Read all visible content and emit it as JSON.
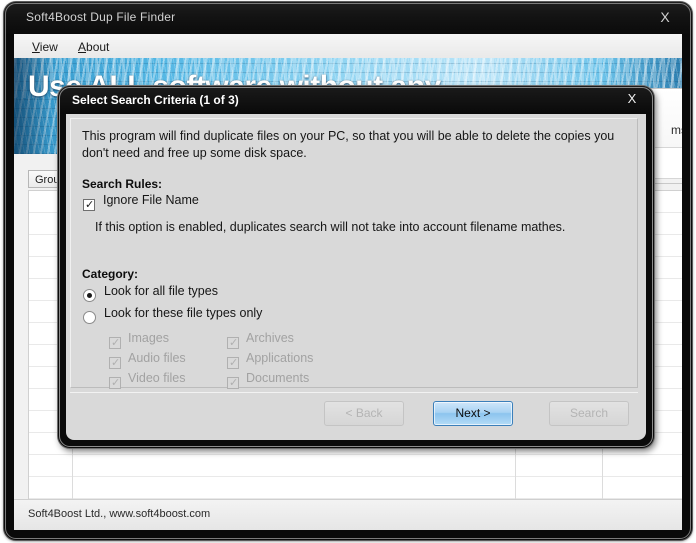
{
  "window": {
    "title": "Soft4Boost Dup File Finder",
    "close_label": "X",
    "menu": [
      {
        "label": "View",
        "accel": "V"
      },
      {
        "label": "About",
        "accel": "A"
      }
    ],
    "banner_text": "Use ALL software without any",
    "side_panel_label": "ms",
    "group_header": "Group",
    "status_text": "Soft4Boost Ltd., www.soft4boost.com"
  },
  "dialog": {
    "title": "Select Search Criteria (1 of 3)",
    "close_label": "X",
    "intro": "This program will find duplicate files on your PC, so that you will be able to delete the copies you don't need and free up some disk space.",
    "search_rules": {
      "title": "Search Rules:",
      "ignore_file_name": {
        "label": "Ignore File Name",
        "checked": true,
        "hint": "If this option is enabled, duplicates search will not take into account filename mathes."
      }
    },
    "category": {
      "title": "Category:",
      "options": [
        {
          "label": "Look for all file types",
          "selected": true
        },
        {
          "label": "Look for these file types only",
          "selected": false
        }
      ],
      "file_types": [
        {
          "label": "Images",
          "checked": true,
          "enabled": false
        },
        {
          "label": "Audio files",
          "checked": true,
          "enabled": false
        },
        {
          "label": "Video files",
          "checked": true,
          "enabled": false
        },
        {
          "label": "Archives",
          "checked": true,
          "enabled": false
        },
        {
          "label": "Applications",
          "checked": true,
          "enabled": false
        },
        {
          "label": "Documents",
          "checked": true,
          "enabled": false
        }
      ]
    },
    "buttons": {
      "back": {
        "label": "< Back",
        "enabled": false
      },
      "next": {
        "label": "Next >",
        "enabled": true,
        "primary": true
      },
      "search": {
        "label": "Search",
        "enabled": false
      }
    }
  },
  "colors": {
    "accent_blue": "#8cc4ee",
    "accent_border": "#3b7fba",
    "banner_blue": "#54b7e4",
    "chrome_black": "#0b0b0b",
    "dialog_face": "#d9d9d9",
    "disabled_text": "#b4b4b4"
  },
  "icons": {
    "check": "✓",
    "close": "✕"
  }
}
